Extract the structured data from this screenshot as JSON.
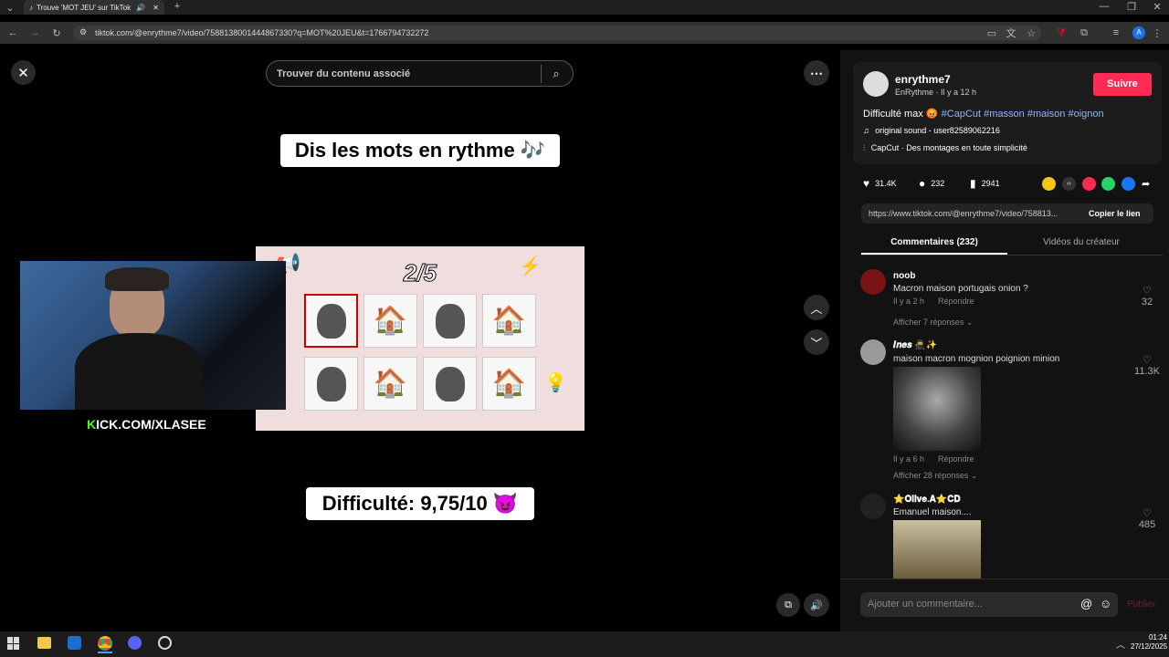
{
  "browser": {
    "tab_title": "Trouve 'MOT JEU' sur TikTok",
    "url": "tiktok.com/@enrythme7/video/7588138001444867330?q=MOT%20JEU&t=1766794732272"
  },
  "video": {
    "search_placeholder": "Trouver du contenu associé",
    "caption_top": "Dis les mots en rythme 🎶",
    "counter": "2/5",
    "caption_bottom": "Difficulté: 9,75/10 😈",
    "grid": [
      "face",
      "house",
      "face",
      "house",
      "face",
      "house",
      "face",
      "house"
    ]
  },
  "stream": {
    "kick_label_prefix": "K",
    "kick_label": "ICK.COM/XLASEE"
  },
  "author": {
    "username": "enrythme7",
    "subtitle": "EnRythme · Il y a 12 h",
    "follow_label": "Suivre",
    "description": "Difficulté max 😡 ",
    "hashtags": [
      "#CapCut",
      "#masson",
      "#maison",
      "#oignon"
    ],
    "sound": "original sound - user82589062216",
    "capcut": "CapCut · Des montages en toute simplicité"
  },
  "stats": {
    "likes": "31.4K",
    "comments": "232",
    "saves": "2941"
  },
  "link": {
    "url": "https://www.tiktok.com/@enrythme7/video/758813...",
    "copy_label": "Copier le lien"
  },
  "tabs": {
    "comments": "Commentaires (232)",
    "creator_videos": "Vidéos du créateur"
  },
  "comments": [
    {
      "name": "noob",
      "text": "Macron maison portugais onion ?",
      "time": "Il y a 2 h",
      "reply": "Répondre",
      "more": "Afficher 7 réponses",
      "likes": "32"
    },
    {
      "name": "𝑰𝒏𝒆𝒔 🥷✨",
      "text": "maison macron mognion poignion minion",
      "time": "Il y a 6 h",
      "reply": "Répondre",
      "more": "Afficher 28 réponses",
      "likes": "11.3K"
    },
    {
      "name": "⭐𝐎𝐥𝐢𝐯𝐞.𝐀⭐𝐂𝐃",
      "text": "Emanuel maison....",
      "likes": "485"
    }
  ],
  "composer": {
    "placeholder": "Ajouter un commentaire...",
    "publish": "Publier"
  },
  "clock": {
    "time": "01:24",
    "date": "27/12/2025"
  },
  "colors": {
    "accent": "#fe2c55",
    "hashtag": "#8fb8ff"
  }
}
